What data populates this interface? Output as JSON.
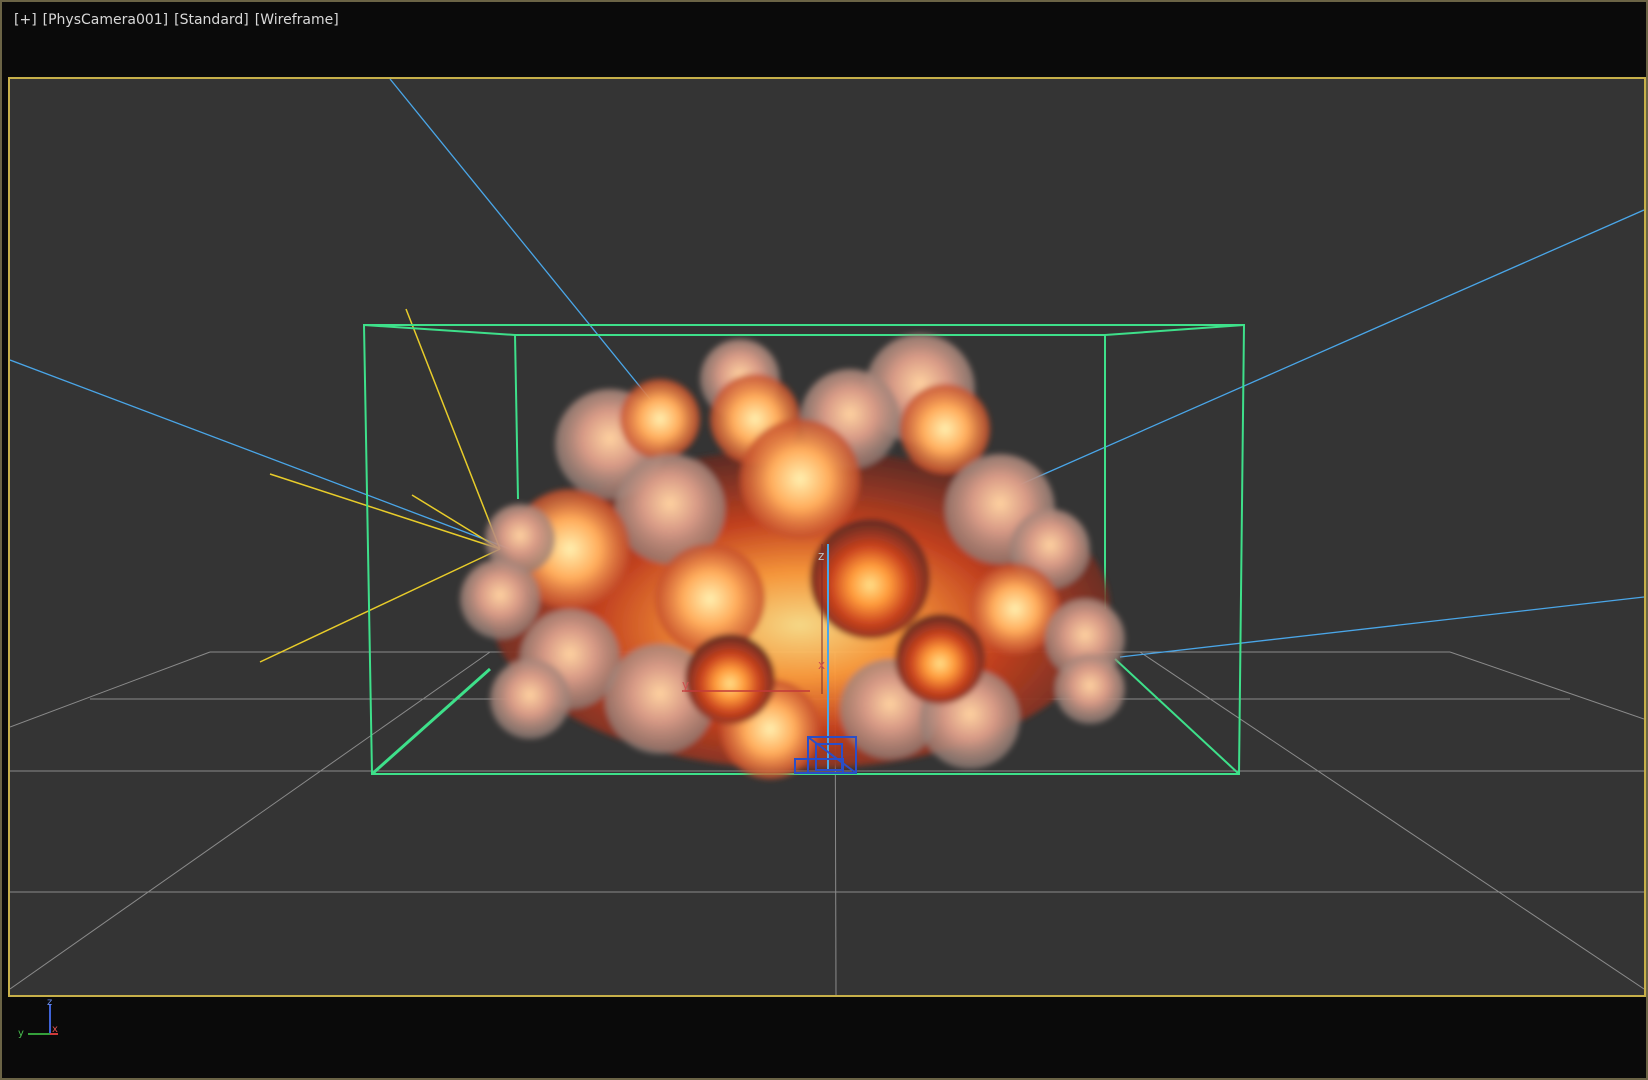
{
  "viewport": {
    "menus": [
      {
        "label": "[+]"
      },
      {
        "label": "[PhysCamera001]"
      },
      {
        "label": "[Standard]"
      },
      {
        "label": "[Wireframe]"
      }
    ]
  },
  "gizmo_labels": {
    "z": "z",
    "x": "x",
    "y": "y"
  },
  "tripod_labels": {
    "z": "z",
    "x": "x",
    "y": "y"
  },
  "colors": {
    "frame_bg": "#0a0a0a",
    "viewport_bg": "#343434",
    "active_border": "#c7b04a",
    "grid": "#9a9a9a",
    "bounding_box": "#3ee08a",
    "light_rays_blue": "#4aa6e8",
    "light_rays_yellow": "#e8cc2a",
    "emitter": "#2a4ec8"
  }
}
